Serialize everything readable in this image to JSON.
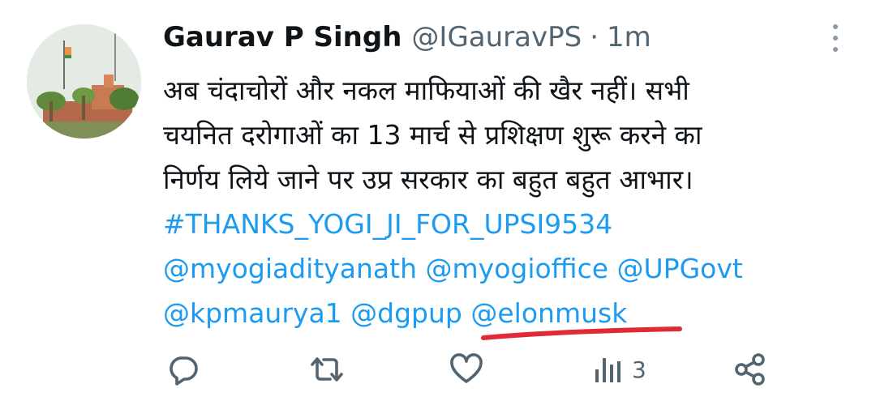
{
  "tweet": {
    "author_name": "Gaurav P Singh",
    "handle": "@IGauravPS",
    "separator": "·",
    "time": "1m",
    "body_lines": [
      "अब चंदाचोरों और नकल माफियाओं की खैर नहीं। सभी",
      "चयनित दरोगाओं का 13 मार्च से प्रशिक्षण शुरू करने का",
      "निर्णय लिये जाने पर उप्र सरकार का बहुत बहुत आभार।"
    ],
    "hashtag": "#THANKS_YOGI_JI_FOR_UPSI9534",
    "mentions": [
      "@myogiadityanath",
      "@myogioffice",
      "@UPGovt",
      "@kpmaurya1",
      "@dgpup",
      "@elonmusk"
    ],
    "highlighted_mention_color": "#e02a37",
    "link_color": "#1d9bf0"
  },
  "actions": {
    "reply_icon": "reply-icon",
    "retweet_icon": "retweet-icon",
    "like_icon": "heart-icon",
    "views_icon": "views-icon",
    "views_count": "3",
    "share_icon": "share-icon"
  }
}
